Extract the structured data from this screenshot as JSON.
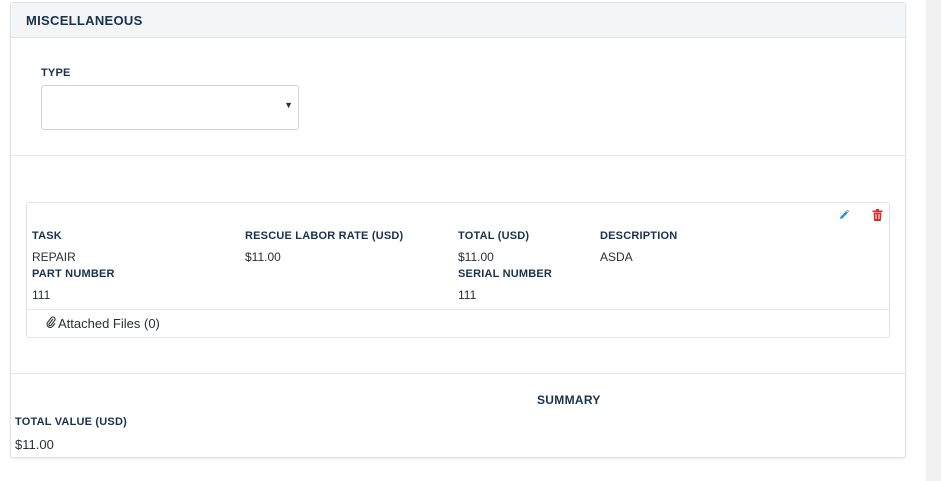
{
  "section": {
    "title": "MISCELLANEOUS"
  },
  "type_field": {
    "label": "TYPE",
    "value": ""
  },
  "item": {
    "task_label": "TASK",
    "task_value": "REPAIR",
    "rate_label": "RESCUE LABOR RATE (USD)",
    "rate_value": "$11.00",
    "total_label": "TOTAL (USD)",
    "total_value": "$11.00",
    "description_label": "DESCRIPTION",
    "description_value": "ASDA",
    "part_number_label": "PART NUMBER",
    "part_number_value": "111",
    "serial_number_label": "SERIAL NUMBER",
    "serial_number_value": "111",
    "attached_files_label": "Attached Files (0)",
    "icons": {
      "edit": "pencil-icon",
      "delete": "trash-icon",
      "attachment": "paperclip-icon"
    }
  },
  "summary": {
    "title": "SUMMARY",
    "total_label": "TOTAL VALUE (USD)",
    "total_value": "$11.00"
  },
  "colors": {
    "edit": "#2f8fd0",
    "delete": "#d62c2c",
    "heading": "#18324d"
  }
}
